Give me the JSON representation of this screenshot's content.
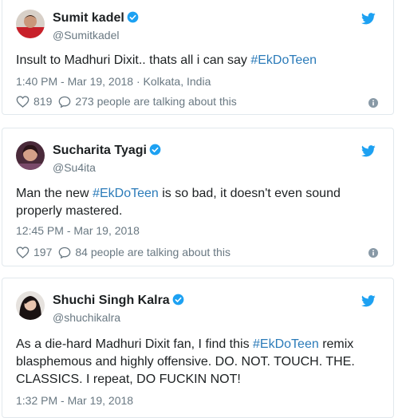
{
  "colors": {
    "accent": "#1da1f2",
    "link": "#2b7bb9",
    "muted": "#697882",
    "text": "#1c2022",
    "border": "#e1e8ed"
  },
  "tweets": [
    {
      "name": "Sumit kadel",
      "handle": "@Sumitkadel",
      "text_before": "Insult to Madhuri Dixit.. thats all i can say ",
      "hashtag": "#EkDoTeen",
      "text_after": "",
      "timestamp": "1:40 PM - Mar 19, 2018",
      "location": " · Kolkata, India",
      "likes": "819",
      "talking": "273 people are talking about this"
    },
    {
      "name": "Sucharita Tyagi",
      "handle": "@Su4ita",
      "text_before": "Man the new ",
      "hashtag": "#EkDoTeen",
      "text_after": " is so bad, it doesn't even sound properly mastered.",
      "timestamp": "12:45 PM - Mar 19, 2018",
      "location": "",
      "likes": "197",
      "talking": "84 people are talking about this"
    },
    {
      "name": "Shuchi Singh Kalra",
      "handle": "@shuchikalra",
      "text_before": "As a die-hard Madhuri Dixit fan, I find this ",
      "hashtag": "#EkDoTeen",
      "text_after": " remix blasphemous and highly offensive. DO. NOT. TOUCH. THE. CLASSICS. I repeat, DO FUCKIN NOT!",
      "timestamp": "1:32 PM - Mar 19, 2018",
      "location": ""
    }
  ]
}
